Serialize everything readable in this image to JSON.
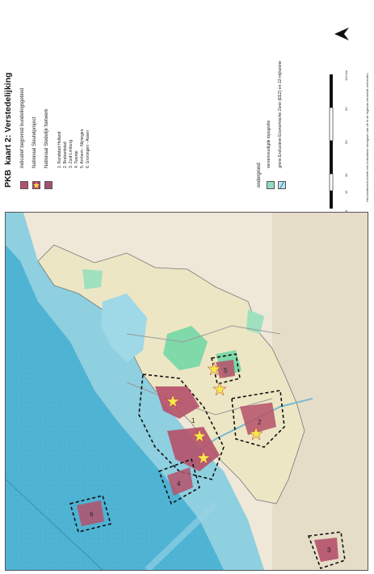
{
  "header": {
    "prefix": "PKB",
    "title": "kaart 2: Verstedelijking"
  },
  "legend": {
    "items": [
      {
        "label": "indicatief begrensd bundelingsgebied",
        "color": "#b5506a"
      },
      {
        "label": "Nationaal Sleutelproject",
        "color": "#c43a66",
        "icon": "star-icon"
      },
      {
        "label": "Nationaal Stedelijk Netwerk",
        "color": "#a24f72"
      }
    ],
    "networks": [
      "1. Randstad Holland",
      "2. Brabantstad",
      "3. Zuid-Limburg",
      "4. Twente",
      "5. Arnhem - Nijmegen",
      "6. Groningen - Assen"
    ],
    "underground_title": "ondergrond",
    "underground_items": [
      {
        "label": "vereenvoudigde topografie",
        "color": "#8fdcc3"
      },
      {
        "label": "grens Exclusieve Economische Zone (EEZ) en 12-mijlszone",
        "color": "#bfe3ef"
      }
    ],
    "scale": {
      "ticks": [
        "0",
        "15",
        "30",
        "60",
        "90",
        "120 km"
      ]
    },
    "north_icon": "north-arrow-icon",
    "note": "Het kaartbeeld betreft een indicatieve weergave van de in de legenda vermelde eenheden."
  },
  "map": {
    "network_labels": [
      "1",
      "2",
      "3",
      "4",
      "5",
      "6"
    ],
    "colors": {
      "sea": "#8ecfe0",
      "sea_deep": "#4fb3d4",
      "land": "#ece6c4",
      "nature": "#7fd9a8",
      "urban": "#b5506a",
      "star": "#f5e84a",
      "dash": "#111111"
    }
  }
}
